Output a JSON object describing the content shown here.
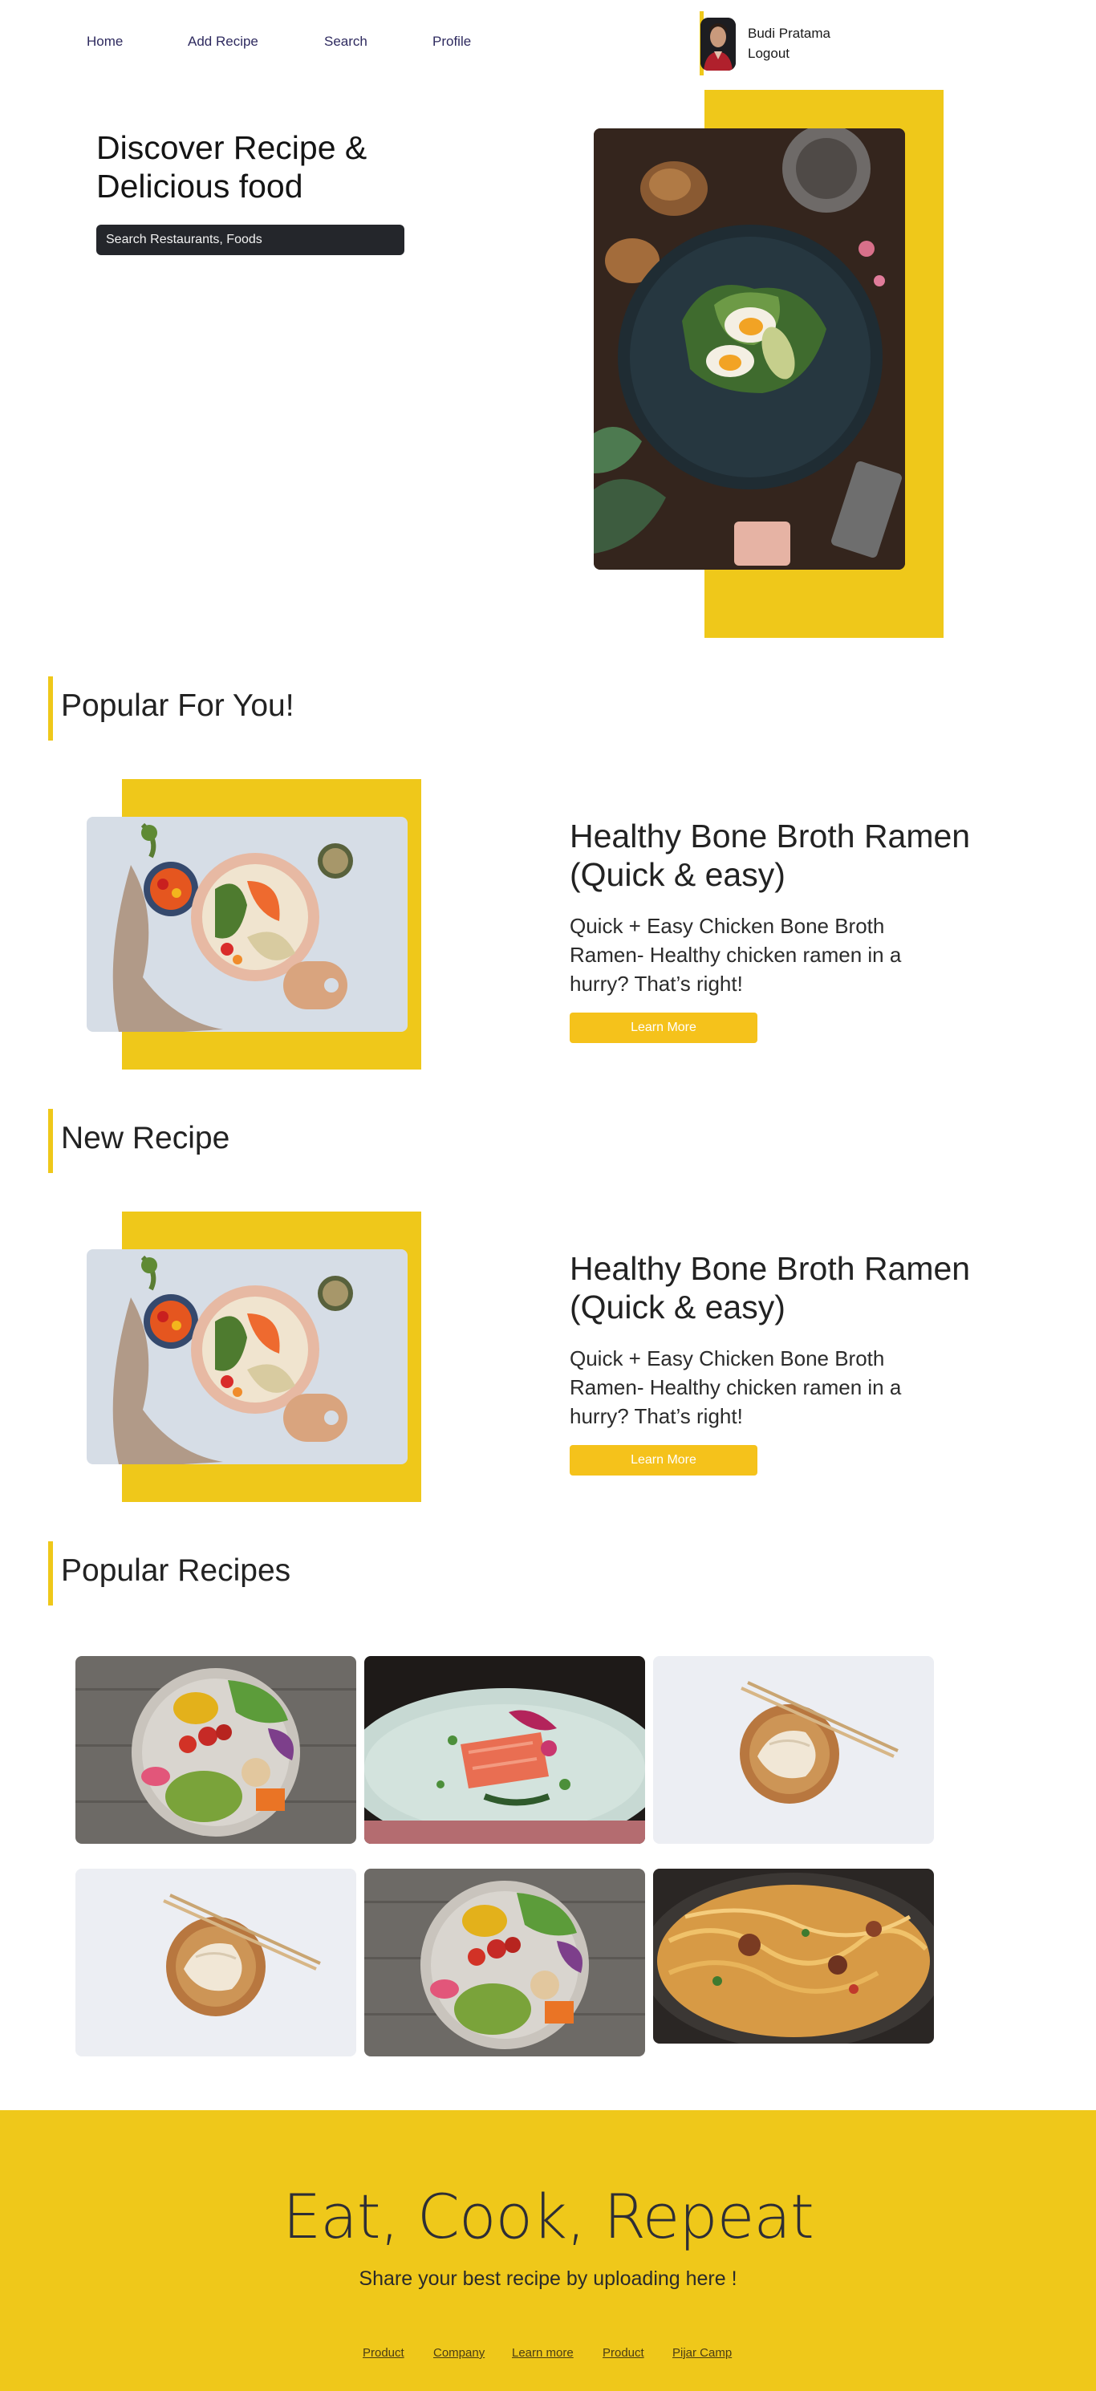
{
  "nav": {
    "home": "Home",
    "add_recipe": "Add Recipe",
    "search": "Search",
    "profile": "Profile"
  },
  "user": {
    "name": "Budi Pratama",
    "logout": "Logout"
  },
  "hero": {
    "title": "Discover Recipe & Delicious food",
    "search_placeholder": "Search Restaurants, Foods"
  },
  "sections": {
    "popular_for_you": "Popular For You!",
    "new_recipe": "New Recipe",
    "popular_recipes": "Popular Recipes"
  },
  "features": [
    {
      "title": "Healthy Bone Broth Ramen (Quick & easy)",
      "description": "Quick + Easy Chicken Bone Broth Ramen- Healthy chicken ramen in a hurry? That’s right!",
      "button": "Learn More"
    },
    {
      "title": "Healthy Bone Broth Ramen (Quick & easy)",
      "description": "Quick + Easy Chicken Bone Broth Ramen- Healthy chicken ramen in a hurry? That’s right!",
      "button": "Learn More"
    }
  ],
  "footer": {
    "title": "Eat, Cook, Repeat",
    "subtitle": "Share your best recipe by uploading here !",
    "links": [
      "Product",
      "Company",
      "Learn more",
      "Product",
      "Pijar Camp"
    ]
  },
  "colors": {
    "accent": "#efc81a",
    "button": "#f5c21b",
    "search_bg": "#24262b",
    "nav_text": "#2e2a5f"
  }
}
